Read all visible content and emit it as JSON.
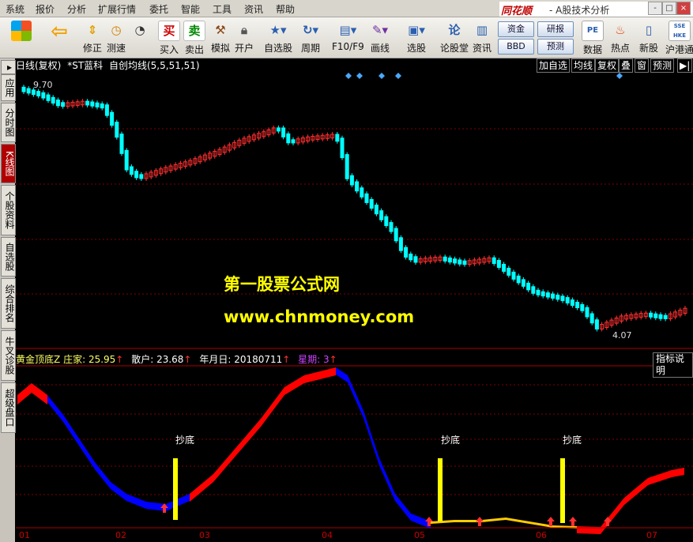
{
  "menu": [
    "系统",
    "报价",
    "分析",
    "扩展行情",
    "委托",
    "智能",
    "工具",
    "资讯",
    "帮助"
  ],
  "brand": "同花顺",
  "app_title": "- A股技术分析",
  "window_buttons": [
    "-",
    "□",
    "×"
  ],
  "toolbar": {
    "left_buttons": [
      {
        "label": "修正",
        "icon": "up-down-arrows-icon"
      },
      {
        "label": "测速",
        "icon": "clock-icon"
      },
      {
        "label": "买入",
        "icon": "buy-icon",
        "glyph": "买"
      },
      {
        "label": "卖出",
        "icon": "sell-icon",
        "glyph": "卖"
      },
      {
        "label": "模拟",
        "icon": "hammer-icon"
      },
      {
        "label": "开户",
        "icon": "lock-icon"
      },
      {
        "label": "自选股",
        "icon": "star-folder-icon"
      },
      {
        "label": "周期",
        "icon": "cycle-icon"
      },
      {
        "label": "F10/F9",
        "icon": "f10-icon"
      },
      {
        "label": "画线",
        "icon": "pencil-icon"
      },
      {
        "label": "选股",
        "icon": "monitor-icon"
      },
      {
        "label": "论股堂",
        "icon": "forum-icon",
        "glyph": "论"
      },
      {
        "label": "资讯",
        "icon": "news-icon"
      }
    ],
    "small_buttons": [
      "资金",
      "研报",
      "BBD",
      "预测"
    ],
    "right_buttons": [
      {
        "label": "数据",
        "icon": "pe-icon",
        "glyph": "PE"
      },
      {
        "label": "热点",
        "icon": "hot-icon"
      },
      {
        "label": "新股",
        "icon": "ipo-icon"
      },
      {
        "label": "沪港通",
        "icon": "sse-hkex-icon",
        "glyph": "SSE HKE"
      }
    ]
  },
  "sidebar_tabs": [
    "应用",
    "分时图",
    "K线图",
    "个股资料",
    "自选股",
    "综合排名",
    "牛叉诊股",
    "超级盘口"
  ],
  "chart_header": {
    "period": "日线(复权)",
    "stock": "*ST蓝科",
    "indicator": "自创均线(5,5,51,51)",
    "buttons": [
      "加自选",
      "均线",
      "复权",
      "叠",
      "窗",
      "预测"
    ],
    "high_label": "9.70",
    "low_label": "4.07"
  },
  "indicator_header": {
    "name": "黄金顶底Z",
    "items": [
      {
        "label": "庄家:",
        "value": "25.95",
        "color": "#ffff66"
      },
      {
        "label": "散户:",
        "value": "23.68",
        "color": "#ffffff"
      },
      {
        "label": "年月日:",
        "value": "20180711",
        "color": "#ffffff"
      },
      {
        "label": "星期:",
        "value": "3",
        "color": "#cc44ff"
      }
    ],
    "button": "指标说明"
  },
  "watermark": {
    "line1": "第一股票公式网",
    "line2": "www.chnmoney.com"
  },
  "signal_label": "抄底",
  "x_axis_labels": [
    "01",
    "02",
    "03",
    "04",
    "05",
    "06",
    "07"
  ],
  "colors": {
    "up": "#ff3030",
    "down": "#00ffff",
    "grid": "#800000",
    "bull_band": "#ff0000",
    "bear_band": "#0000ff",
    "signal": "#ffff00"
  }
}
